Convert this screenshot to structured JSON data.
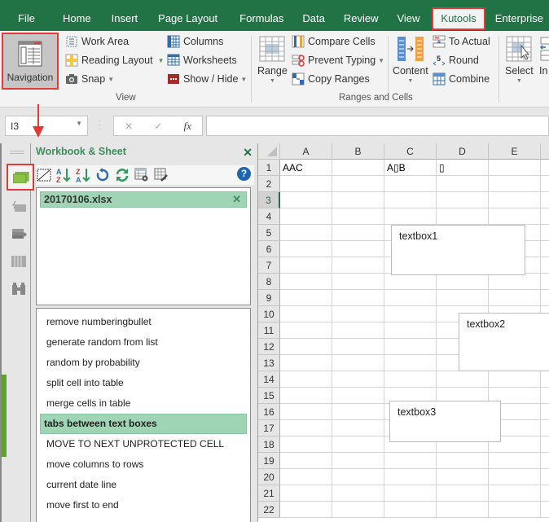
{
  "ribbon_tabs": [
    {
      "label": "File"
    },
    {
      "label": "Home"
    },
    {
      "label": "Insert"
    },
    {
      "label": "Page Layout"
    },
    {
      "label": "Formulas"
    },
    {
      "label": "Data"
    },
    {
      "label": "Review"
    },
    {
      "label": "View"
    },
    {
      "label": "Kutools",
      "active": true
    },
    {
      "label": "Enterprise"
    }
  ],
  "ribbon": {
    "navigation": "Navigation",
    "work_area": "Work Area",
    "reading_layout": "Reading Layout",
    "snap": "Snap",
    "columns": "Columns",
    "worksheets": "Worksheets",
    "show_hide": "Show / Hide",
    "group_view": "View",
    "range": "Range",
    "compare_cells": "Compare Cells",
    "prevent_typing": "Prevent Typing",
    "copy_ranges": "Copy Ranges",
    "content": "Content",
    "to_actual": "To Actual",
    "round": "Round",
    "combine": "Combine",
    "group_ranges": "Ranges and Cells",
    "select": "Select",
    "insert_partial": "In"
  },
  "formula_bar": {
    "name_box": "I3",
    "cancel": "✕",
    "enter": "✓",
    "fx": "fx",
    "value": ""
  },
  "pane": {
    "title": "Workbook & Sheet",
    "close": "✕",
    "help": "?",
    "workbooks": [
      {
        "name": "20170106.xlsx",
        "close": "✕"
      }
    ],
    "sheets": [
      {
        "name": "remove numberingbullet"
      },
      {
        "name": "generate random from list"
      },
      {
        "name": "random by probability"
      },
      {
        "name": "split cell into table"
      },
      {
        "name": "merge cells in table"
      },
      {
        "name": "tabs between text boxes",
        "selected": true
      },
      {
        "name": "MOVE TO NEXT UNPROTECTED CELL"
      },
      {
        "name": "move columns to rows"
      },
      {
        "name": "current date line"
      },
      {
        "name": "move first to end"
      }
    ]
  },
  "sheet": {
    "columns": [
      "A",
      "B",
      "C",
      "D",
      "E"
    ],
    "rows": [
      "1",
      "2",
      "3",
      "4",
      "5",
      "6",
      "7",
      "8",
      "9",
      "10",
      "11",
      "12",
      "13",
      "14",
      "15",
      "16",
      "17",
      "18",
      "19",
      "20",
      "21",
      "22"
    ],
    "active_row": "3",
    "cells": {
      "A1": "AAC",
      "C1": "A▯B",
      "D1": "▯"
    },
    "textboxes": [
      "textbox1",
      "textbox2",
      "textbox3"
    ]
  },
  "colors": {
    "excel_green": "#217346",
    "highlight_red": "#e53935",
    "selected_item": "#9fd5b5",
    "pane_title": "#3c8e5f"
  }
}
